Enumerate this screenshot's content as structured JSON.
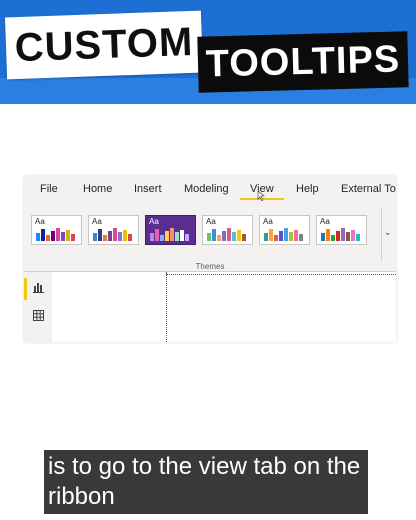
{
  "banner": {
    "title_word_1": "CUSTOM",
    "title_word_2": "TOOLTIPS",
    "colors": {
      "background": "#1d6fd4",
      "label_light": "#ffffff",
      "label_dark": "#0b0b0b"
    }
  },
  "ribbon": {
    "tabs": [
      {
        "label": "File"
      },
      {
        "label": "Home"
      },
      {
        "label": "Insert"
      },
      {
        "label": "Modeling"
      },
      {
        "label": "View",
        "active": true
      },
      {
        "label": "Help"
      },
      {
        "label": "External Tools"
      }
    ],
    "themes_group_label": "Themes",
    "theme_tiles": [
      {
        "aa": "Aa",
        "selected": false,
        "bars": [
          "#118dff",
          "#12239e",
          "#e66c37",
          "#6b007b",
          "#e044a7",
          "#744ec2",
          "#d9b300",
          "#d64550"
        ]
      },
      {
        "aa": "Aa",
        "selected": false,
        "bars": [
          "#3b86c8",
          "#293f7f",
          "#e07b39",
          "#7a3e8f",
          "#d94d8f",
          "#8d6bd1",
          "#e5c100",
          "#c94f4f"
        ]
      },
      {
        "aa": "Aa",
        "selected": true,
        "bars": [
          "#b58ae0",
          "#e85fb5",
          "#7fb1ff",
          "#ffd24a",
          "#f58f6e",
          "#9be2c6",
          "#ffffff",
          "#c7a4ff"
        ]
      },
      {
        "aa": "Aa",
        "selected": false,
        "bars": [
          "#6fbf73",
          "#3a8fd6",
          "#f0a35e",
          "#8e63c7",
          "#d95d8a",
          "#4fc3c9",
          "#f2c811",
          "#a05a2c"
        ]
      },
      {
        "aa": "Aa",
        "selected": false,
        "bars": [
          "#2f9e8f",
          "#f2a93b",
          "#e45756",
          "#5a4fcf",
          "#47a3e0",
          "#9bc53d",
          "#f46a9b",
          "#7f7f7f"
        ]
      },
      {
        "aa": "Aa",
        "selected": false,
        "bars": [
          "#1f77b4",
          "#ff7f0e",
          "#2ca02c",
          "#d62728",
          "#9467bd",
          "#8c564b",
          "#e377c2",
          "#17becf"
        ]
      }
    ],
    "accent_color": "#f2c811",
    "icons": {
      "cursor": "hand-pointer-icon",
      "more_themes": "chevron-down-icon",
      "report_view": "bar-chart-icon",
      "data_view": "table-grid-icon"
    }
  },
  "caption": {
    "text": "is to go to the view tab on the ribbon"
  }
}
